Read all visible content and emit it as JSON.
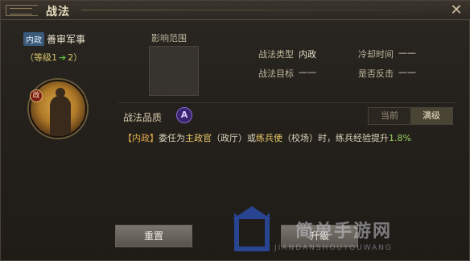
{
  "window": {
    "title": "战法",
    "close_icon": "close-icon"
  },
  "skill": {
    "type_tag": "内政",
    "name": "善审军事",
    "level_prefix": "（等级",
    "level_from": "1",
    "level_arrow": "➔",
    "level_to": "2",
    "level_suffix": "）",
    "portrait_badge": "政"
  },
  "range": {
    "label": "影响范围"
  },
  "info": {
    "type_label": "战法类型",
    "type_value": "内政",
    "cooldown_label": "冷却时间",
    "cooldown_value": "——",
    "target_label": "战法目标",
    "target_value": "——",
    "counter_label": "是否反击",
    "counter_value": "——"
  },
  "quality": {
    "label": "战法品质",
    "grade": "A"
  },
  "toggle": {
    "current": "当前",
    "max": "满级"
  },
  "description": {
    "tag": "【内政】",
    "p1": "委任为",
    "role1": "主政官",
    "p2": "（政厅）或",
    "role2": "练兵使",
    "p3": "（校场）时，练兵经验提升",
    "value": "1.8%"
  },
  "buttons": {
    "reset": "重置",
    "upgrade": "升级"
  },
  "watermark": {
    "text": "简单手游网",
    "sub": "JIANDANSHOUYOUWANG"
  }
}
